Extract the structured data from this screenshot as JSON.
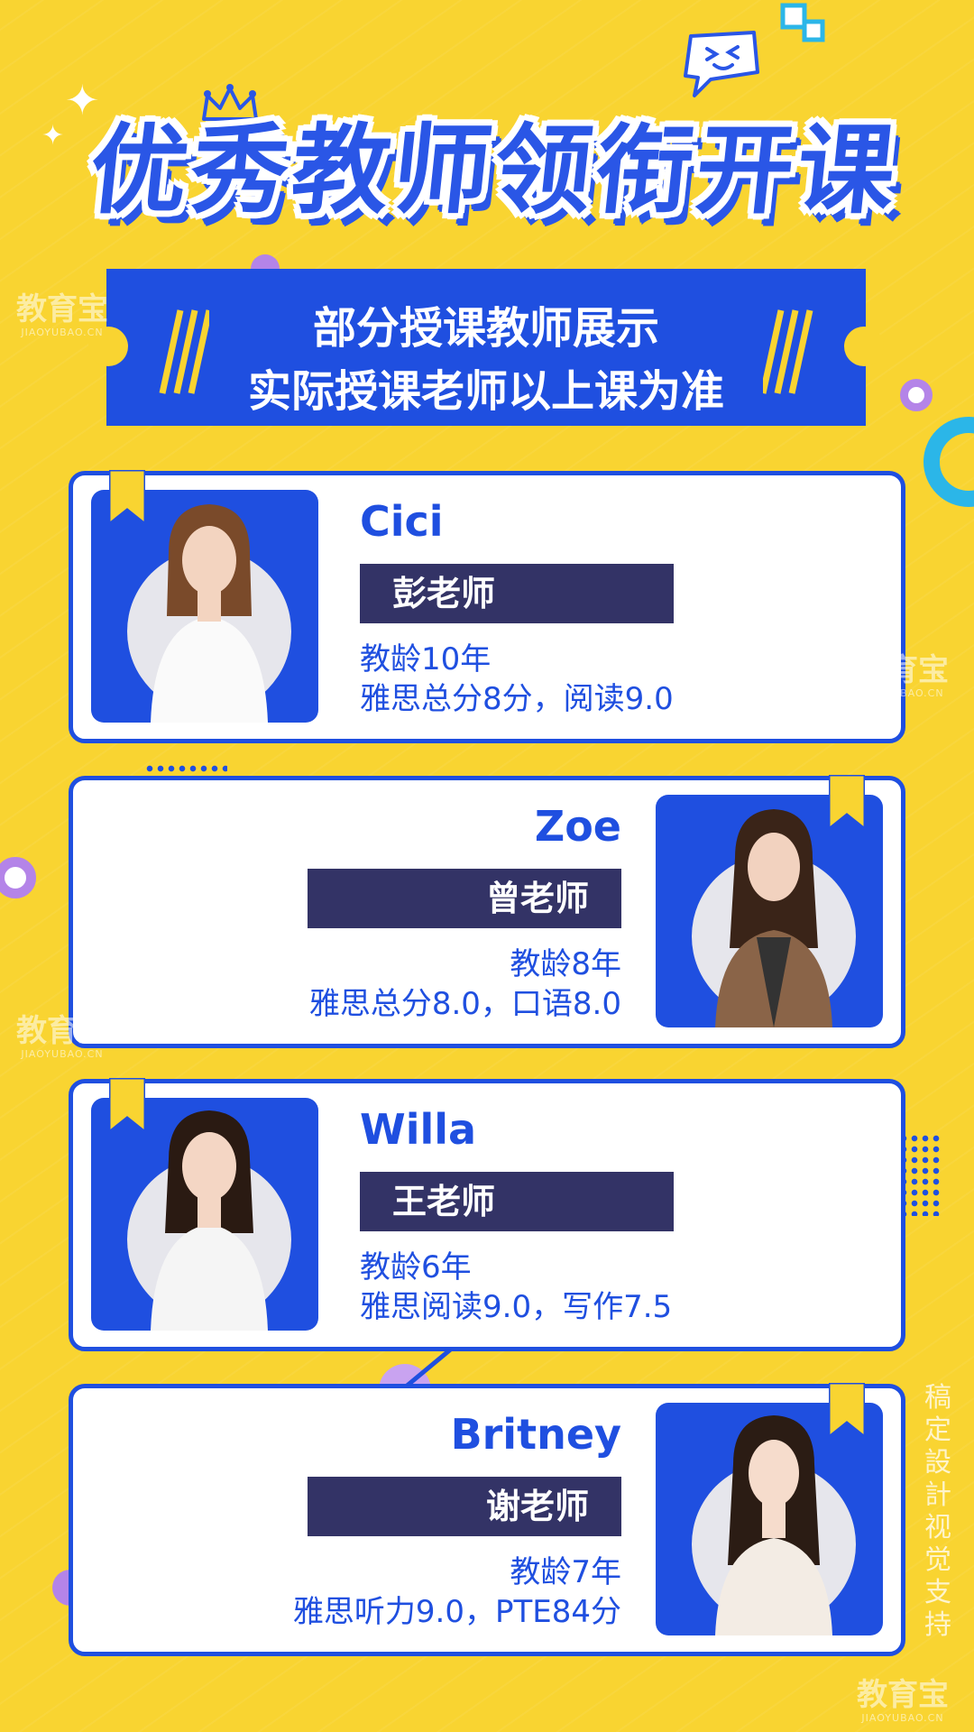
{
  "headline": "优秀教师领衔开课",
  "banner": {
    "line1": "部分授课教师展示",
    "line2": "实际授课老师以上课为准"
  },
  "teachers": [
    {
      "name": "Cici",
      "title": "彭老师",
      "detail1": "教龄10年",
      "detail2": "雅思总分8分，阅读9.0"
    },
    {
      "name": "Zoe",
      "title": "曾老师",
      "detail1": "教龄8年",
      "detail2": "雅思总分8.0，口语8.0"
    },
    {
      "name": "Willa",
      "title": "王老师",
      "detail1": "教龄6年",
      "detail2": "雅思阅读9.0，写作7.5"
    },
    {
      "name": "Britney",
      "title": "谢老师",
      "detail1": "教龄7年",
      "detail2": "雅思听力9.0，PTE84分"
    }
  ],
  "watermark": {
    "brand": "教育宝",
    "domain": "JIAOYUBAO.CN"
  },
  "credit": "稿定設計视觉支持",
  "colors": {
    "background": "#f9d431",
    "accent": "#1f4fe0",
    "title_bar": "#333366"
  },
  "icons": [
    "sparkle-icon",
    "crown-icon",
    "emoji-bubble-icon",
    "bookmark-icon"
  ]
}
